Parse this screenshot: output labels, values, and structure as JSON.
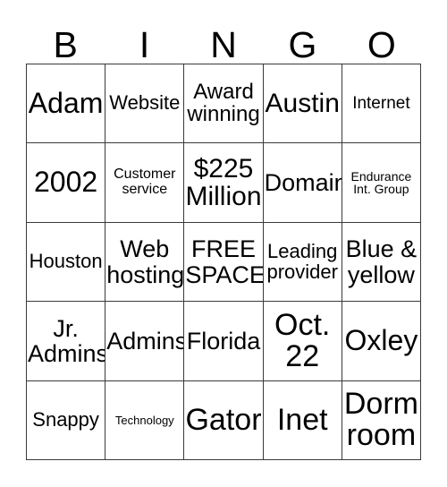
{
  "card": {
    "title_letters": [
      "B",
      "I",
      "N",
      "G",
      "O"
    ],
    "columns": 5,
    "rows": 5,
    "colors": {
      "background": "#ffffff",
      "border": "#3a3a3a",
      "text": "#000000"
    },
    "free_space_label": "FREE SPACE",
    "cells": [
      [
        {
          "text": "Adam",
          "size": "fs-xl"
        },
        {
          "text": "Website",
          "size": "fs-sm"
        },
        {
          "text": "Award\nwinning",
          "size": "fs-m"
        },
        {
          "text": "Austin",
          "size": "fs-l"
        },
        {
          "text": "Internet",
          "size": "fs-s"
        }
      ],
      [
        {
          "text": "2002",
          "size": "fs-xl"
        },
        {
          "text": "Customer\nservice",
          "size": "fs-xs"
        },
        {
          "text": "$225\nMillion",
          "size": "fs-l"
        },
        {
          "text": "Domain",
          "size": "fs-ml"
        },
        {
          "text": "Endurance\nInt. Group",
          "size": "fs-xxs"
        }
      ],
      [
        {
          "text": "Houston",
          "size": "fs-sm"
        },
        {
          "text": "Web\nhosting",
          "size": "fs-ml"
        },
        {
          "text": "FREE\nSPACE",
          "size": "fs-ml"
        },
        {
          "text": "Leading\nprovider",
          "size": "fs-sm"
        },
        {
          "text": "Blue &\nyellow",
          "size": "fs-ml"
        }
      ],
      [
        {
          "text": "Jr.\nAdmins",
          "size": "fs-ml"
        },
        {
          "text": "Admins",
          "size": "fs-ml"
        },
        {
          "text": "Florida",
          "size": "fs-ml"
        },
        {
          "text": "Oct.\n22",
          "size": "fs-xxl"
        },
        {
          "text": "Oxley",
          "size": "fs-xl"
        }
      ],
      [
        {
          "text": "Snappy",
          "size": "fs-sm"
        },
        {
          "text": "Technology",
          "size": "fs-tiny"
        },
        {
          "text": "Gator",
          "size": "fs-xxl"
        },
        {
          "text": "Inet",
          "size": "fs-xxl"
        },
        {
          "text": "Dorm\nroom",
          "size": "fs-xxl"
        }
      ]
    ]
  }
}
